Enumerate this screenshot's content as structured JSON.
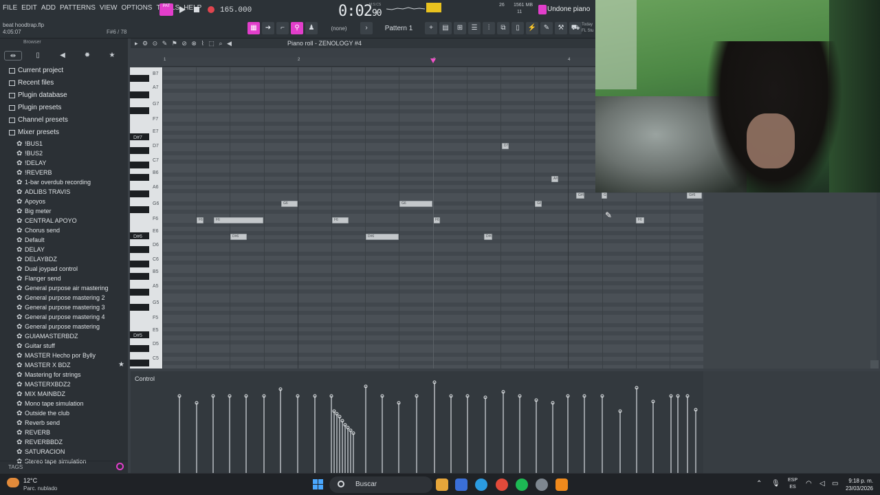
{
  "menu": [
    "FILE",
    "EDIT",
    "ADD",
    "PATTERNS",
    "VIEW",
    "OPTIONS",
    "TOOLS",
    "HELP"
  ],
  "project": {
    "file": "beat hoodtrap.flp",
    "time": "4:05:07",
    "hint": "F#6 / 78"
  },
  "transport": {
    "pat_label": "PAT",
    "tempo": "165.000",
    "time_main": "0:02",
    "time_sub": "90",
    "time_label": "M:S:CS"
  },
  "cpu": {
    "mem": "1561 MB",
    "v1": "26",
    "v2": "11"
  },
  "hint_bar": "Undone piano",
  "toolbar2": {
    "none": "(none)",
    "pattern": "Pattern 1",
    "today": "Today",
    "studio": "FL Stu"
  },
  "browser": {
    "title": "Browser",
    "folders": [
      "Current project",
      "Recent files",
      "Plugin database",
      "Plugin presets",
      "Channel presets",
      "Mixer presets"
    ],
    "presets": [
      "!BUS1",
      "!BUS2",
      "!DELAY",
      "!REVERB",
      "1-bar overdub recording",
      "ADLIBS TRAVIS",
      "Apoyos",
      "Big meter",
      "CENTRAL APOYO",
      "Chorus send",
      "Default",
      "DELAY",
      "DELAYBDZ",
      "Dual joypad control",
      "Flanger send",
      "General purpose air mastering",
      "General purpose mastering 2",
      "General purpose mastering 3",
      "General purpose mastering 4",
      "General purpose mastering",
      "GUIAMASTERBDZ",
      "Guitar stuff",
      "MASTER Hecho por Bylly",
      "MASTER X BDZ",
      "Mastering for strings",
      "MASTERXBDZ2",
      "MIX MAINBDZ",
      "Mono tape simulation",
      "Outside the club",
      "Reverb send",
      "REVERB",
      "REVERBBDZ",
      "SATURACION",
      "Stereo tape simulation"
    ],
    "starred": "MASTER X BDZ",
    "tags": "TAGS"
  },
  "piano_roll": {
    "title": "Piano roll - ZENOLOGY #4",
    "bars": [
      "1",
      "2",
      "3",
      "4"
    ],
    "key_labels": [
      "B7",
      "A7",
      "G7",
      "F7",
      "E7",
      "D#7",
      "D7",
      "C7",
      "B6",
      "A6",
      "G6",
      "F6",
      "E6",
      "D#6",
      "D6",
      "C6",
      "B5",
      "A5",
      "G5",
      "F5",
      "E5",
      "D#5",
      "D5",
      "C5"
    ],
    "notes": [
      {
        "label": "D7"
      },
      {
        "label": "A#6"
      },
      {
        "label": "G#6"
      },
      {
        "label": "G"
      },
      {
        "label": "G#6"
      },
      {
        "label": "G6"
      },
      {
        "label": "G6"
      },
      {
        "label": "G6"
      },
      {
        "label": "F6"
      },
      {
        "label": "F6"
      },
      {
        "label": "F6"
      },
      {
        "label": "F6"
      },
      {
        "label": "F6"
      },
      {
        "label": "D#6"
      },
      {
        "label": "D#6"
      },
      {
        "label": "D#6"
      }
    ],
    "control_label": "Control"
  },
  "taskbar": {
    "temp": "12°C",
    "weather": "Parc. nublado",
    "search": "Buscar",
    "lang_top": "ESP",
    "lang_bottom": "ES",
    "clock": "9:18 p. m.",
    "date": "23/03/2026"
  },
  "colors": {
    "accent": "#e23ecb",
    "note": "#c4c8cb",
    "grid": "#4a5056"
  }
}
